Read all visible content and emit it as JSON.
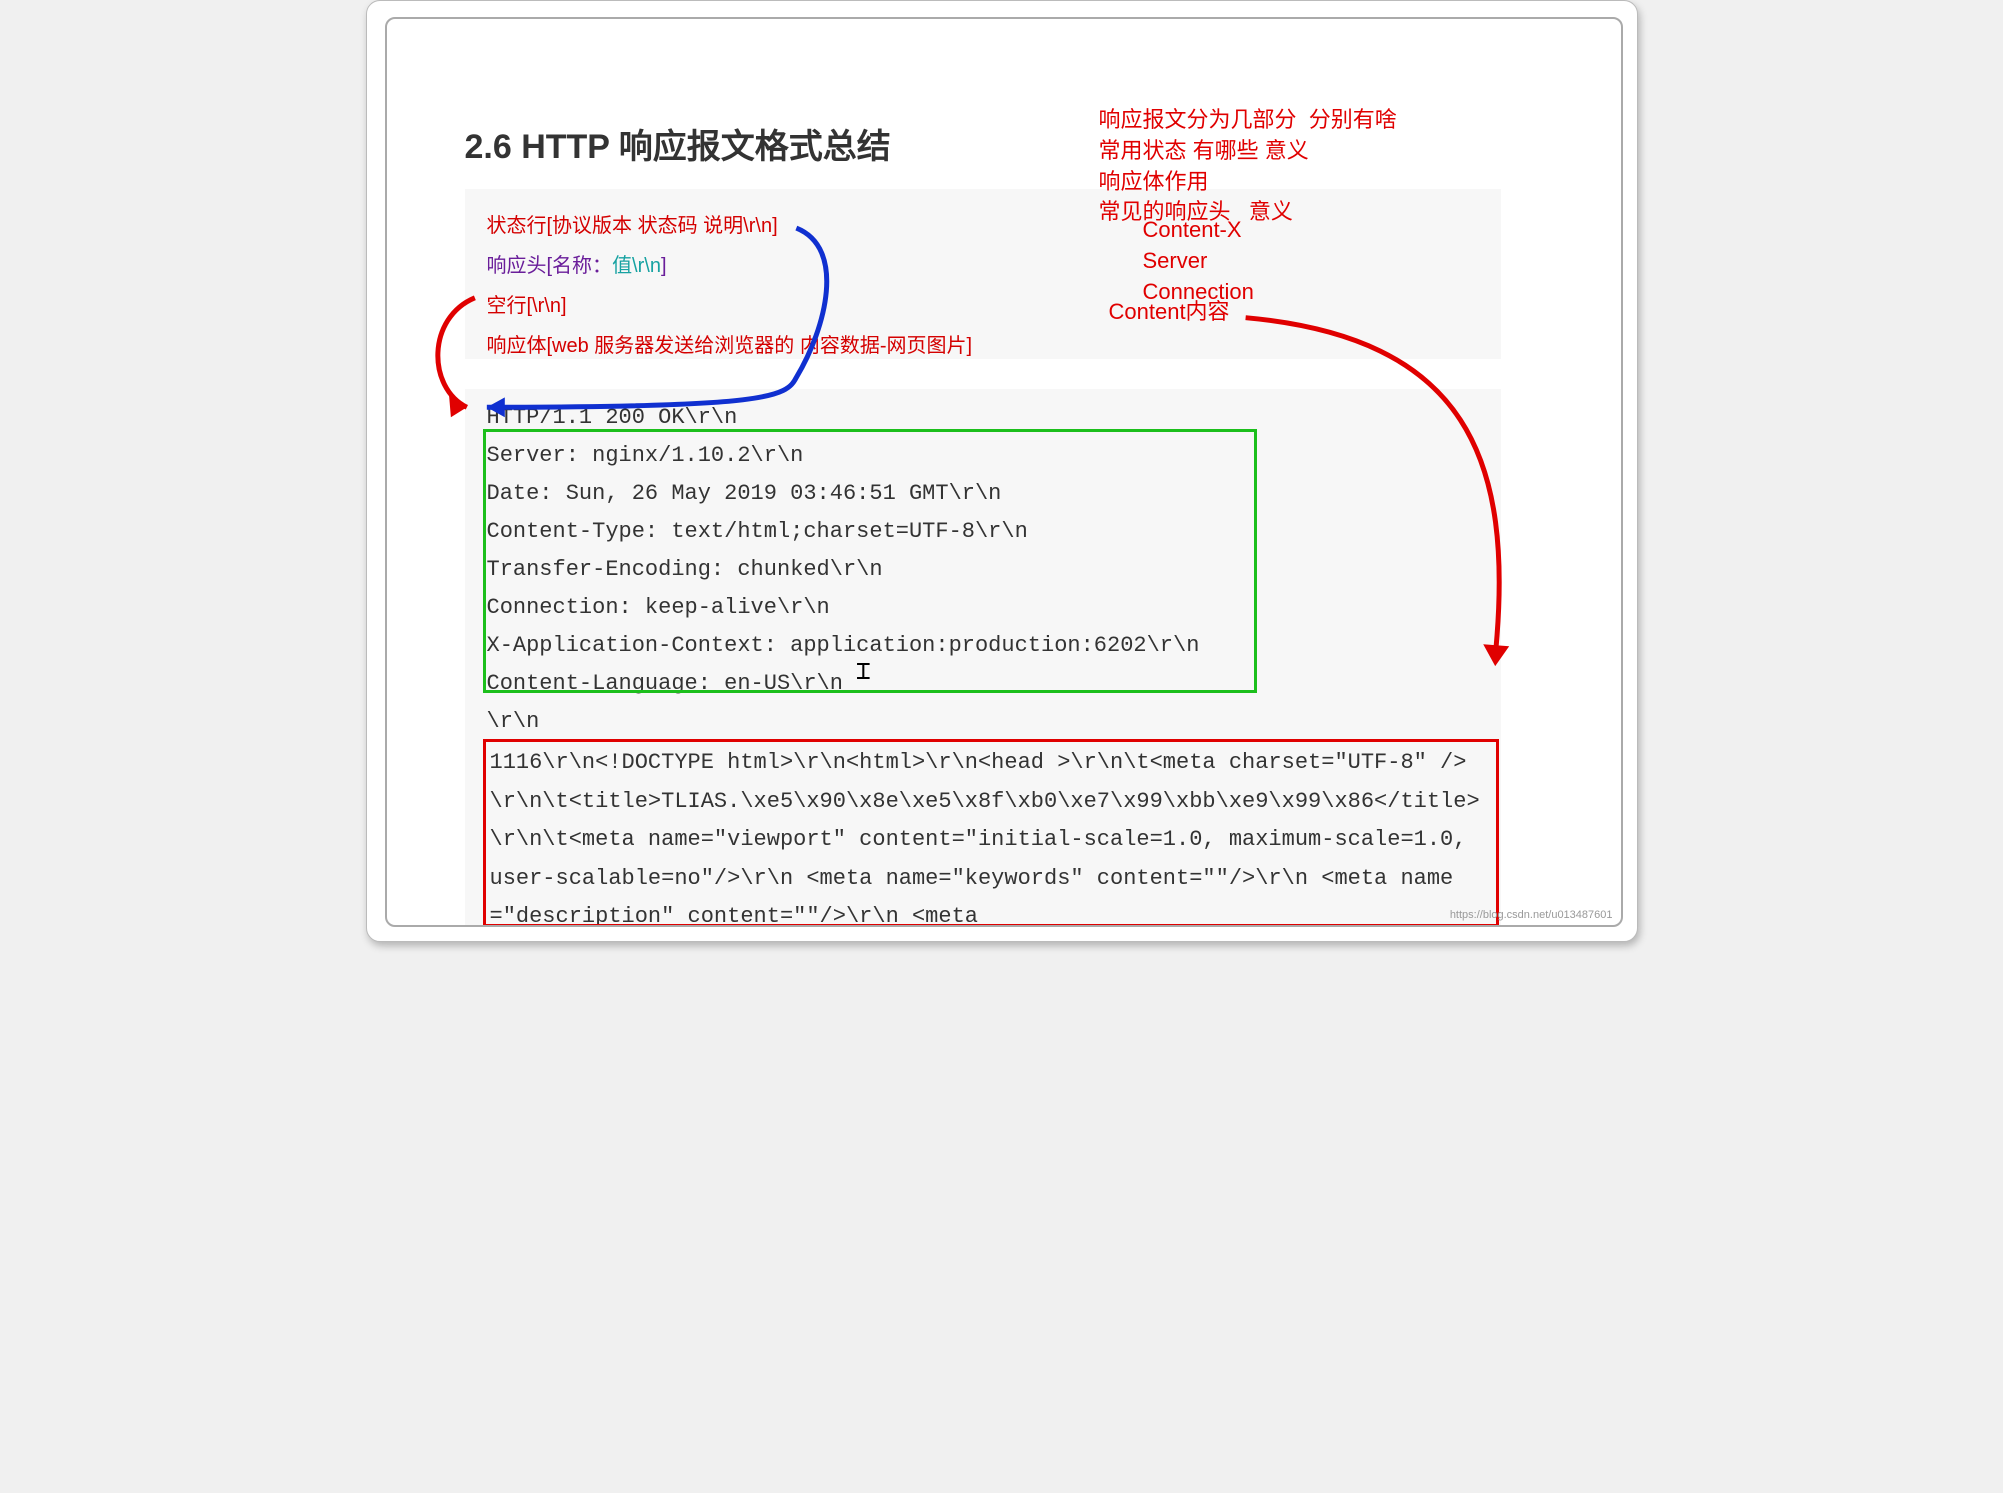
{
  "title": "2.6 HTTP 响应报文格式总结",
  "grey": {
    "line1": "状态行[协议版本  状态码  说明\\r\\n]",
    "line2a": "响应头[名称：",
    "line2b": "值\\r\\n",
    "line2c": "]",
    "line3": "空行[\\r\\n]",
    "line4": "响应体[web  服务器发送给浏览器的  内容数据-网页图片]"
  },
  "code": {
    "status": "HTTP/1.1 200 OK\\r\\n",
    "h1": "Server: nginx/1.10.2\\r\\n",
    "h2": "Date: Sun, 26 May 2019 03:46:51 GMT\\r\\n",
    "h3": "Content-Type: text/html;charset=UTF-8\\r\\n",
    "h4": "Transfer-Encoding: chunked\\r\\n",
    "h5": "Connection: keep-alive\\r\\n",
    "h6": "X-Application-Context: application:production:6202\\r\\n",
    "h7": "Content-Language: en-US\\r\\n",
    "blank": "\\r\\n",
    "body": "1116\\r\\n<!DOCTYPE html>\\r\\n<html>\\r\\n<head >\\r\\n\\t<meta charset=\"UTF-8\" />\\r\\n\\t<title>TLIAS.\\xe5\\x90\\x8e\\xe5\\x8f\\xb0\\xe7\\x99\\xbb\\xe9\\x99\\x86</title>\\r\\n\\t<meta name=\"viewport\" content=\"initial-scale=1.0, maximum-scale=1.0, user-scalable=no\"/>\\r\\n    <meta name=\"keywords\" content=\"\"/>\\r\\n    <meta name=\"description\" content=\"\"/>\\r\\n    <meta"
  },
  "notes": {
    "block1": "响应报文分为几部分  分别有啥\n常用状态 有哪些 意义\n响应体作用\n常见的响应头   意义",
    "block2": "Content-X\nServer\nConnection",
    "block3": "Content内容"
  },
  "watermark": "https://blog.csdn.net/u013487601"
}
